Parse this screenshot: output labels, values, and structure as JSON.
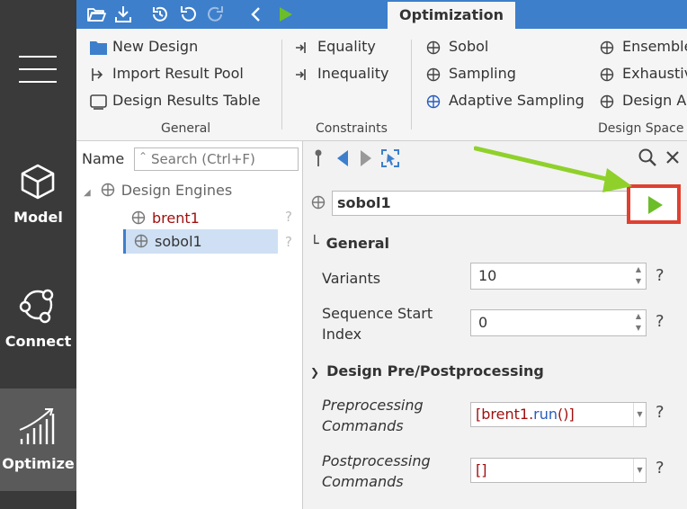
{
  "rail": {
    "items": [
      {
        "label": "Model"
      },
      {
        "label": "Connect"
      },
      {
        "label": "Optimize"
      }
    ]
  },
  "topbar": {
    "tab_label": "Optimization"
  },
  "ribbon": {
    "general": {
      "group_label": "General",
      "new_design": "New Design",
      "import_result_pool": "Import Result Pool",
      "design_results_table": "Design Results Table"
    },
    "constraints": {
      "group_label": "Constraints",
      "equality": "Equality",
      "inequality": "Inequality"
    },
    "design_space": {
      "group_label": "Design Space E",
      "sobol": "Sobol",
      "sampling": "Sampling",
      "adaptive_sampling": "Adaptive Sampling",
      "ensemble": "Ensemble",
      "exhaustive": "Exhaustiv",
      "design_as": "Design As"
    }
  },
  "tree": {
    "name_label": "Name",
    "search_placeholder": "Search (Ctrl+F)",
    "root": "Design Engines",
    "children": [
      {
        "label": "brent1",
        "help": "?"
      },
      {
        "label": "sobol1",
        "help": "?"
      }
    ]
  },
  "props": {
    "name_value": "sobol1",
    "general": {
      "header": "General",
      "variants_label": "Variants",
      "variants_value": "10",
      "seq_start_label_1": "Sequence Start",
      "seq_start_label_2": "Index",
      "seq_start_value": "0"
    },
    "prepost": {
      "header": "Design Pre/Postprocessing",
      "pre_label_1": "Preprocessing",
      "pre_label_2": "Commands",
      "pre_open": "[brent1.",
      "pre_call": "run",
      "pre_close": "()]",
      "post_label_1": "Postprocessing",
      "post_label_2": "Commands",
      "post_value": "[]"
    },
    "help": "?"
  },
  "colors": {
    "rail_bg": "#3a3a3a",
    "topbar_bg": "#3d7fcb",
    "run_green": "#6cbd2a",
    "highlight_red": "#e04030",
    "arrow_green": "#8fd12a",
    "selected_bg": "#cfe0f4"
  }
}
